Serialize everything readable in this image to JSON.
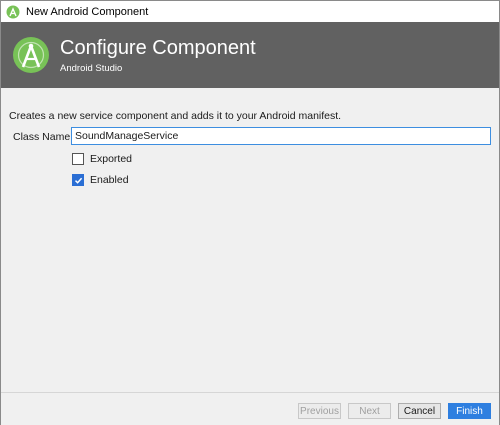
{
  "window": {
    "title": "New Android Component"
  },
  "header": {
    "heading": "Configure Component",
    "subheading": "Android Studio",
    "logo_icon": "android-studio-icon",
    "background": "#616161"
  },
  "form": {
    "description": "Creates a new service component and adds it to your Android manifest.",
    "class_name_label": "Class Name:",
    "class_name_value": "SoundManageService",
    "exported": {
      "label": "Exported",
      "checked": false
    },
    "enabled": {
      "label": "Enabled",
      "checked": true
    }
  },
  "footer": {
    "previous_label": "Previous",
    "next_label": "Next",
    "cancel_label": "Cancel",
    "finish_label": "Finish",
    "accent": "#2e7fe0"
  }
}
